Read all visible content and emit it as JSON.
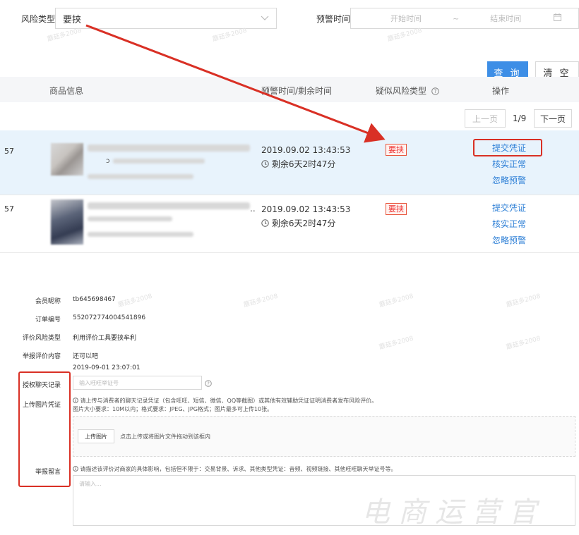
{
  "filters": {
    "risk_type_label": "风险类型",
    "risk_type_value": "要挟",
    "warning_time_label": "预警时间",
    "start_placeholder": "开始时间",
    "range_sep": "~",
    "end_placeholder": "结束时间",
    "query_button": "查 询",
    "clear_button": "清 空"
  },
  "table": {
    "columns": [
      "商品信息",
      "预警时间/剩余时间",
      "疑似风险类型",
      "操作"
    ],
    "pager": {
      "prev": "上一页",
      "page": "1/9",
      "next": "下一页"
    },
    "rows": [
      {
        "id_fragment": "57",
        "title_fragment": "ɔ",
        "warning_time": "2019.09.02 13:43:53",
        "remaining": "剩余6天2时47分",
        "risk_tag": "要挟",
        "actions": [
          "提交凭证",
          "核实正常",
          "忽略预警"
        ]
      },
      {
        "id_fragment": "57",
        "title_fragment": "..",
        "warning_time": "2019.09.02 13:43:53",
        "remaining": "剩余6天2时47分",
        "risk_tag": "要挟",
        "actions": [
          "提交凭证",
          "核实正常",
          "忽略预警"
        ]
      }
    ]
  },
  "form": {
    "member_nick_label": "会员昵称",
    "member_nick_value": "tb645698467",
    "order_no_label": "订单编号",
    "order_no_value": "552072774004541896",
    "risk_type_label": "评价风险类型",
    "risk_type_value": "利用评价工具要挟牟利",
    "review_content_label": "举报评价内容",
    "review_content_value": "还可以吧",
    "review_time": "2019-09-01 23:07:01",
    "chat_record_label": "授权聊天记录",
    "chat_record_placeholder": "输入旺旺举证号",
    "upload_label": "上传图片凭证",
    "upload_hint_1": "请上传与消费者的聊天记录凭证（包含旺旺、短信、微信、QQ等截图）或其他有效辅助凭证证明消费者发布风险评价。",
    "upload_hint_2": "图片大小要求：10M以内；格式要求：JPEG、JPG格式；图片最多可上传10张。",
    "upload_button": "上传图片",
    "upload_drag_hint": "点击上传或将图片文件拖动到该框内",
    "message_label": "举报留言",
    "message_hint": "请描述该评价对商家的具体影响，包括但不限于：交易背景、诉求、其他类型凭证：音频、视频链接、其他旺旺聊天举证号等。",
    "message_placeholder": "请输入..."
  },
  "watermarks": {
    "small": "蘑菇多2008",
    "brand": "电商运营官"
  },
  "colors": {
    "primary": "#3d8ee6",
    "link": "#2d7fd6",
    "annotation_red": "#d93025",
    "tag_red": "#e33",
    "highlight_row": "#e8f3fc"
  },
  "icons": [
    "chevron-down-icon",
    "calendar-icon",
    "help-circle-icon",
    "clock-icon",
    "info-icon"
  ]
}
